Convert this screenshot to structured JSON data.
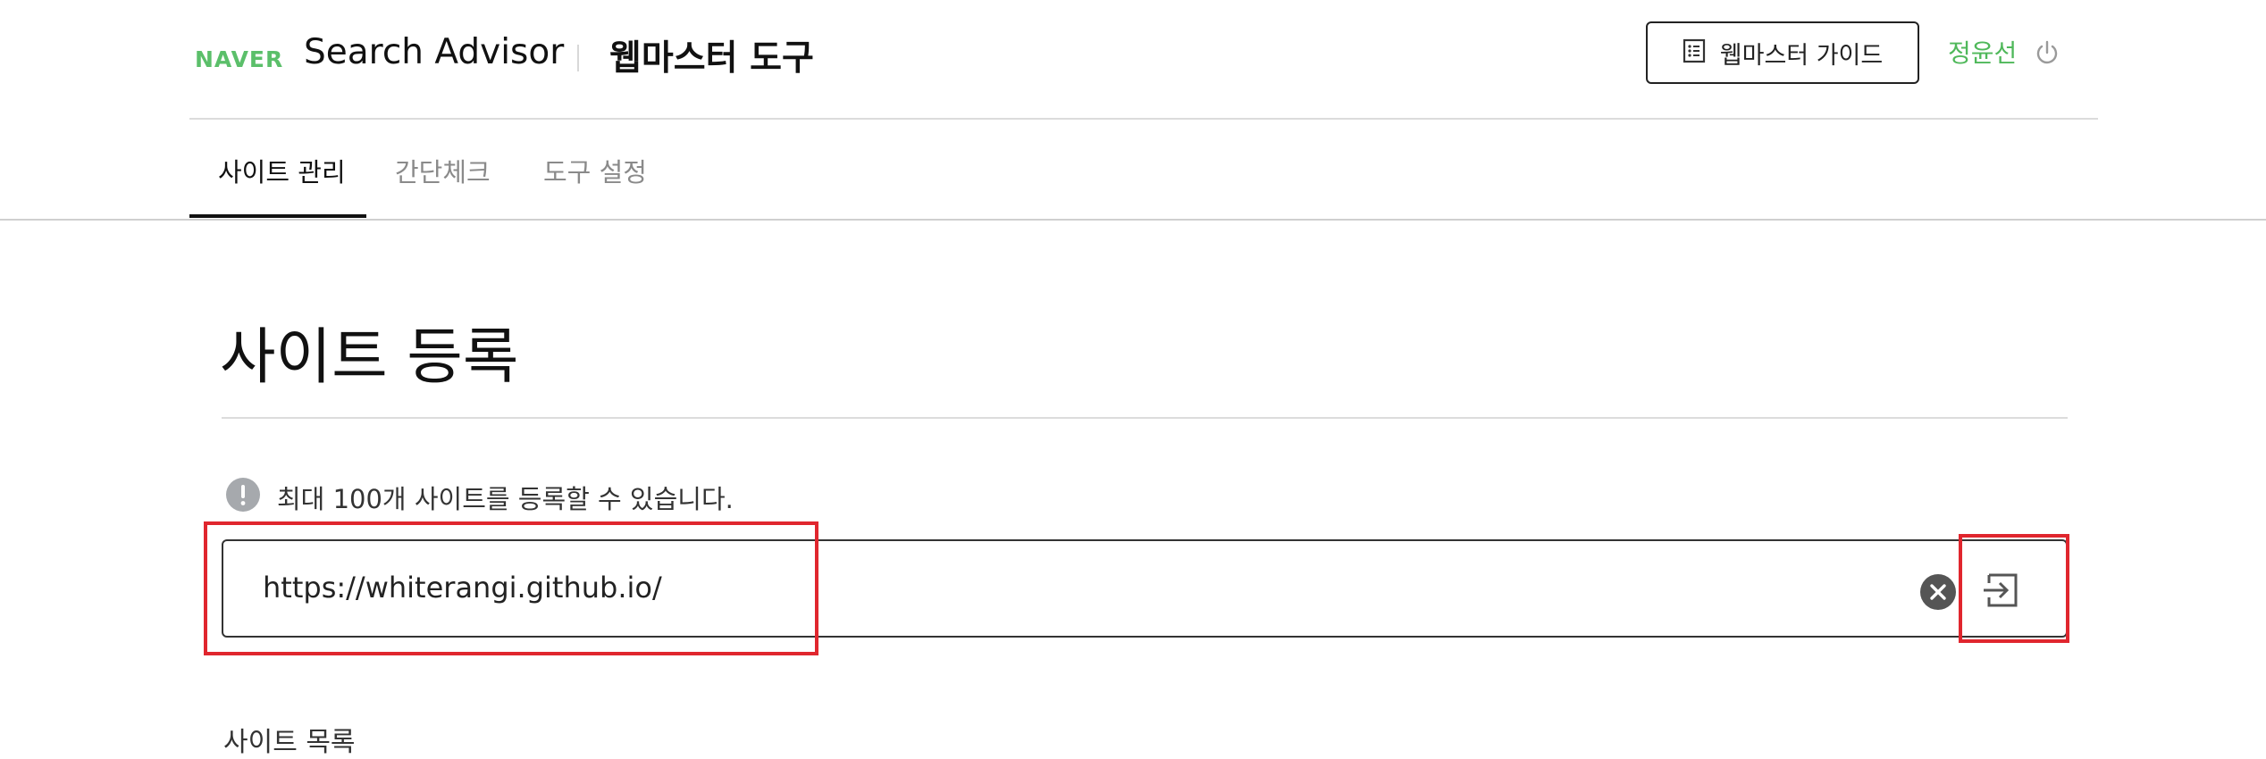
{
  "header": {
    "logo_text": "NAVER",
    "app_name": "Search Advisor",
    "app_sub": "웹마스터 도구",
    "guide_button": "웹마스터 가이드",
    "user_name": "정윤선",
    "icons": {
      "guide": "list-document-icon",
      "power": "power-icon"
    }
  },
  "tabs": [
    {
      "label": "사이트 관리",
      "active": true
    },
    {
      "label": "간단체크",
      "active": false
    },
    {
      "label": "도구 설정",
      "active": false
    }
  ],
  "main": {
    "title": "사이트 등록",
    "notice": "최대 100개 사이트를 등록할 수 있습니다.",
    "url_value": "https://whiterangi.github.io/",
    "icons": {
      "notice": "exclamation-icon",
      "clear": "clear-circle-icon",
      "submit": "enter-arrow-icon"
    },
    "bottom_partial_text": "사이트 목록"
  },
  "colors": {
    "brand_green": "#5bbf6a",
    "highlight_red": "#e0262e"
  }
}
